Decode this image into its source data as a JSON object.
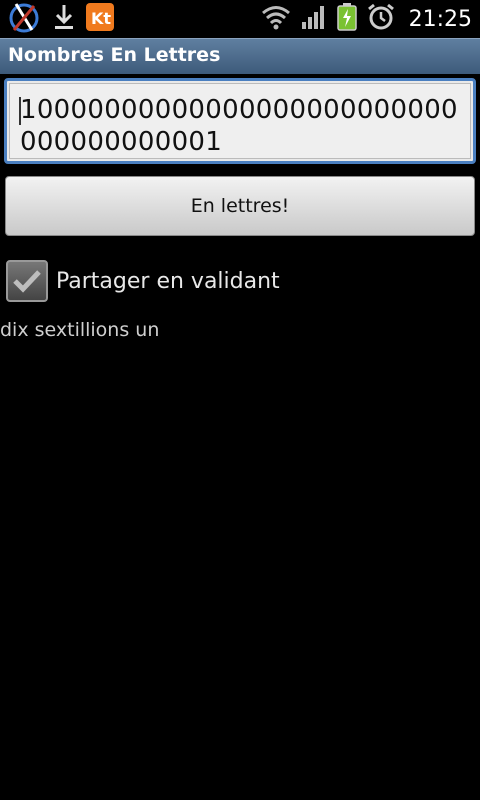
{
  "status_bar": {
    "time": "21:25",
    "left_icons": [
      "satellite-nav-icon",
      "download-icon",
      "kt-app-icon"
    ],
    "right_icons": [
      "wifi-icon",
      "signal-icon",
      "battery-charging-icon",
      "alarm-icon"
    ]
  },
  "app": {
    "title": "Nombres En Lettres"
  },
  "number_input": {
    "value": "10000000000000000000000000000000000001"
  },
  "convert_button": {
    "label": "En lettres!"
  },
  "share_checkbox": {
    "label": "Partager en validant",
    "checked": true
  },
  "result": {
    "text": "dix sextillions un"
  },
  "colors": {
    "title_bar": "#3d5a7a",
    "focus_border": "#4a7fc0",
    "battery": "#7ac231",
    "kt_orange": "#f07a1e"
  }
}
